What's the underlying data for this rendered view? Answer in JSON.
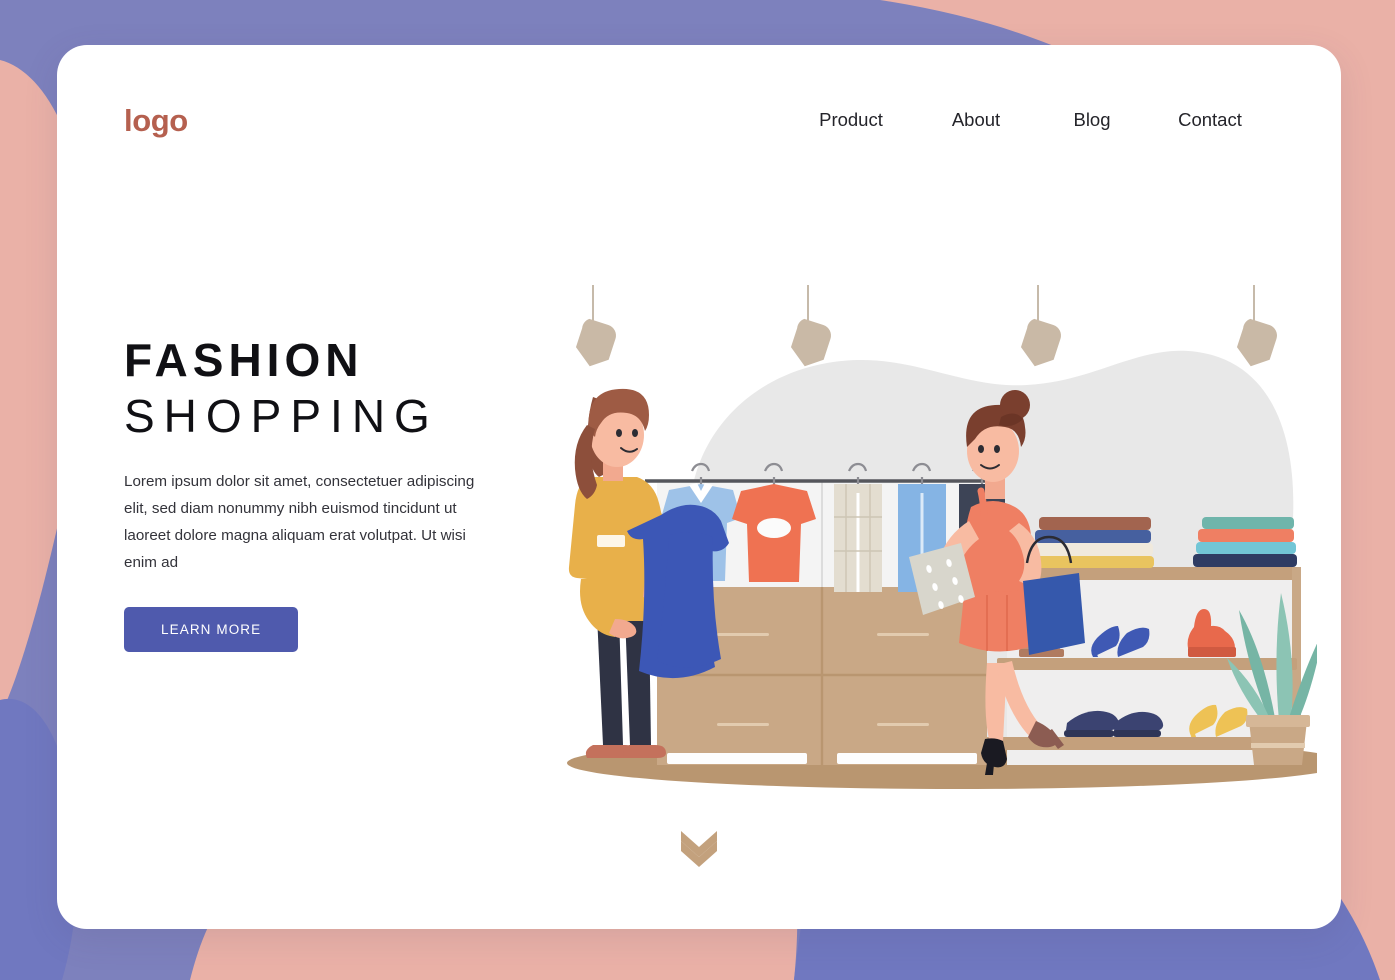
{
  "page": {
    "background_purple": "#7d81bd",
    "background_pink": "#eab1a7",
    "card_background": "#ffffff"
  },
  "header": {
    "logo": "logo",
    "logo_color": "#b5604f",
    "nav": [
      {
        "label": "Product"
      },
      {
        "label": "About"
      },
      {
        "label": "Blog"
      },
      {
        "label": "Contact"
      }
    ]
  },
  "hero": {
    "title_line1": "FASHION",
    "title_line2": "SHOPPING",
    "paragraph": "Lorem ipsum dolor sit amet, consectetuer adipiscing elit, sed diam nonummy nibh euismod tincidunt ut laoreet dolore magna aliquam erat volutpat. Ut wisi enim ad",
    "cta_label": "LEARN MORE",
    "cta_color": "#4f5aad"
  },
  "illustration": {
    "name": "fashion-store-shopping-scene",
    "backdrop_blob_color": "#e7e7e7",
    "hanging_tags_count": 4,
    "hanging_tag_color": "#c9b9a6",
    "figures": [
      {
        "name": "shop-assistant",
        "top_color": "#e8b04a",
        "pants_color": "#2f3344",
        "hair_color": "#9e5b44",
        "shoes_color": "#c4715c",
        "holding": "blue-dress",
        "holding_color": "#3c57b6"
      },
      {
        "name": "shopper",
        "dress_color": "#ef7f63",
        "hair_color": "#7a3f2e",
        "shoes_color": "#1a1a22",
        "bag_color": "#3558ac",
        "holding": "folded-garment"
      }
    ],
    "rack_items": [
      "light-blue-shirt",
      "coral-tshirt",
      "beige-plaid-pants",
      "light-blue-jeans",
      "navy-pants"
    ],
    "shelf_shoes": [
      "tan-boot",
      "blue-heels",
      "orange-boot",
      "navy-sneakers",
      "yellow-heels",
      "brown-heels"
    ],
    "plant_color": "#74b3a3",
    "plant_pot_color": "#c9a886",
    "floor_color": "#b99670"
  },
  "scroll_cue": {
    "name": "scroll-down-chevrons",
    "color": "#c3a17d"
  }
}
